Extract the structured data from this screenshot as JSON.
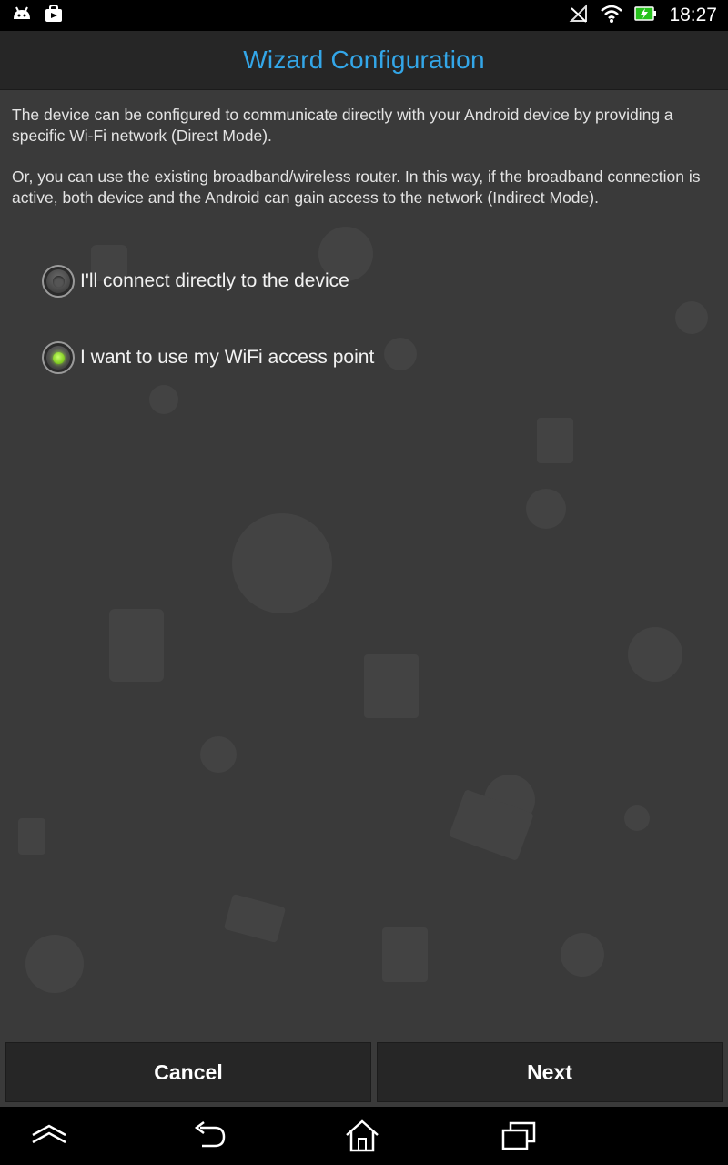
{
  "status_bar": {
    "time": "18:27",
    "left_icons": [
      "android-notification-icon",
      "store-notification-icon"
    ],
    "right_icons": [
      "signal-off-icon",
      "wifi-icon",
      "battery-charging-icon"
    ]
  },
  "header": {
    "title": "Wizard Configuration"
  },
  "main": {
    "paragraphs": [
      "The device can be configured to communicate directly with your Android device by providing a specific Wi-Fi network (Direct Mode).",
      "Or, you can use the existing broadband/wireless router. In this way, if the broadband connection is active, both device and the Android can gain access to the network (Indirect Mode)."
    ],
    "options": [
      {
        "label": "I'll connect directly to the device",
        "selected": false
      },
      {
        "label": "I want to use my WiFi access point",
        "selected": true
      }
    ]
  },
  "buttons": {
    "cancel_label": "Cancel",
    "next_label": "Next"
  },
  "nav_bar": {
    "icons": [
      "collapse-icon",
      "back-icon",
      "home-icon",
      "recent-apps-icon"
    ]
  },
  "colors": {
    "title": "#33a6e8",
    "background": "#3a3a3a",
    "selected_radio": "#7bc71c"
  }
}
